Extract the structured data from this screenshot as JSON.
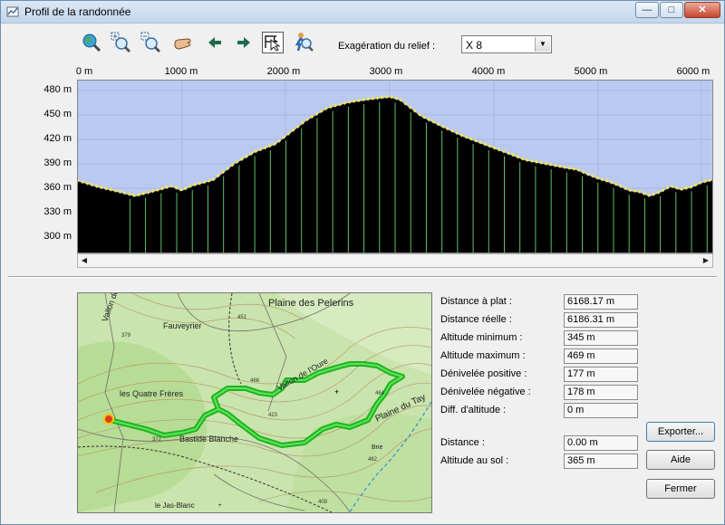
{
  "window": {
    "title": "Profil de la randonnée",
    "controls": {
      "minimize": "—",
      "maximize": "□",
      "close": "✕"
    }
  },
  "toolbar": {
    "tools": [
      {
        "name": "zoom-extent-tool",
        "icon": "globe-magnifier-icon"
      },
      {
        "name": "zoom-in-tool",
        "icon": "zoom-in-icon"
      },
      {
        "name": "zoom-out-tool",
        "icon": "zoom-out-icon"
      },
      {
        "name": "pan-tool",
        "icon": "hand-icon"
      },
      {
        "name": "previous-tool",
        "icon": "arrow-left-icon"
      },
      {
        "name": "next-tool",
        "icon": "arrow-right-icon"
      },
      {
        "name": "profile-select-tool",
        "icon": "profile-cursor-icon",
        "active": true
      },
      {
        "name": "locate-tool",
        "icon": "locate-person-icon"
      }
    ],
    "exaggeration_label": "Exagération du relief :",
    "exaggeration_value": "X 8"
  },
  "chart_data": {
    "type": "area",
    "xlabel": "",
    "ylabel": "",
    "x_ticks": [
      "0 m",
      "1000 m",
      "2000 m",
      "3000 m",
      "4000 m",
      "5000 m",
      "6000 m"
    ],
    "y_ticks": [
      "480 m",
      "450 m",
      "420 m",
      "390 m",
      "360 m",
      "330 m",
      "300 m"
    ],
    "xlim": [
      0,
      6100
    ],
    "ylim": [
      275,
      490
    ],
    "grid": true,
    "series": [
      {
        "x": [
          0,
          200,
          400,
          550,
          700,
          900,
          1000,
          1100,
          1300,
          1500,
          1700,
          1900,
          2000,
          2200,
          2400,
          2600,
          2800,
          3000,
          3100,
          3200,
          3300,
          3500,
          3700,
          3900,
          4100,
          4300,
          4500,
          4700,
          4800,
          4900,
          5000,
          5100,
          5200,
          5300,
          5400,
          5500,
          5600,
          5700,
          5800,
          5900,
          6000,
          6100
        ],
        "y": [
          364,
          356,
          350,
          345,
          350,
          357,
          352,
          358,
          365,
          385,
          400,
          410,
          420,
          440,
          455,
          462,
          466,
          469,
          465,
          455,
          445,
          432,
          420,
          410,
          400,
          390,
          385,
          380,
          378,
          372,
          367,
          363,
          358,
          352,
          350,
          345,
          350,
          357,
          353,
          356,
          362,
          365
        ]
      }
    ]
  },
  "stats": [
    {
      "label": "Distance à plat :",
      "value": "6168.17 m"
    },
    {
      "label": "Distance réelle :",
      "value": "6186.31 m"
    },
    {
      "label": "Altitude minimum :",
      "value": "345 m"
    },
    {
      "label": "Altitude maximum :",
      "value": "469 m"
    },
    {
      "label": "Dénivelée positive :",
      "value": "177 m"
    },
    {
      "label": "Dénivelée négative :",
      "value": "178 m"
    },
    {
      "label": "Diff. d'altitude :",
      "value": "0 m"
    }
  ],
  "cursor": [
    {
      "label": "Distance :",
      "value": "0.00 m"
    },
    {
      "label": "Altitude au sol :",
      "value": "365 m"
    }
  ],
  "buttons": {
    "export": "Exporter...",
    "help": "Aide",
    "close": "Fermer"
  },
  "map": {
    "labels": {
      "plaine_pelegrin": "Plaine des Pelerins",
      "vallon_fauvet": "Vallon de Fauvet",
      "fauveyrier": "Fauveyrier",
      "quatre_freres": "les Quatre Frères",
      "bastide_blanche": "Bastide Blanche",
      "vallon_oure": "Vallon de l'Oure",
      "plaine_tay": "Plaine du Tay",
      "jas_blanc": "le Jas-Blanc",
      "bne": "Bne"
    },
    "spot_heights": [
      "379",
      "451",
      "466",
      "423",
      "464",
      "372",
      "462",
      "409"
    ]
  }
}
